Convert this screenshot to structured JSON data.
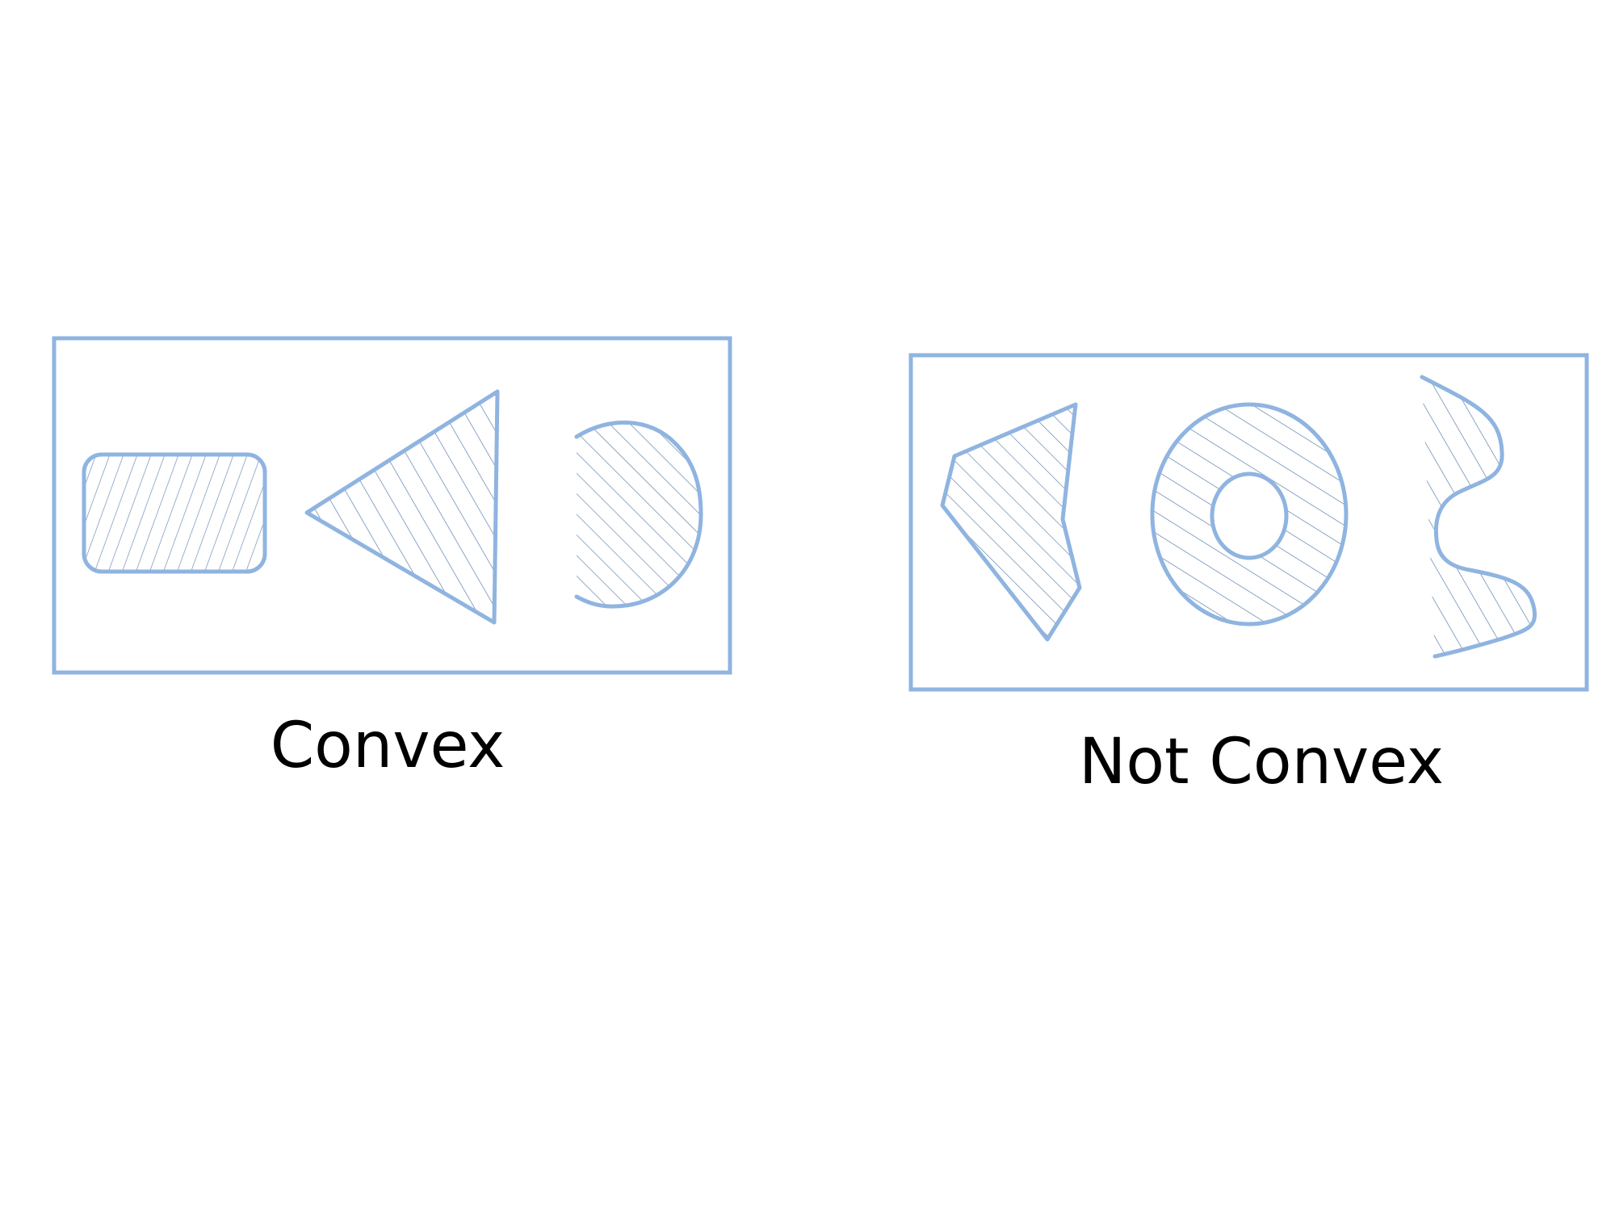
{
  "colors": {
    "outline": "#8fb4e0",
    "hatch": "#6f8fb5",
    "caption": "#000000",
    "background": "#ffffff"
  },
  "panels": {
    "convex": {
      "caption": "Convex",
      "shapes": [
        "rounded-rectangle",
        "triangle",
        "half-disc"
      ]
    },
    "not_convex": {
      "caption": "Not Convex",
      "shapes": [
        "notched-polygon",
        "ring",
        "wavy-region"
      ]
    }
  }
}
